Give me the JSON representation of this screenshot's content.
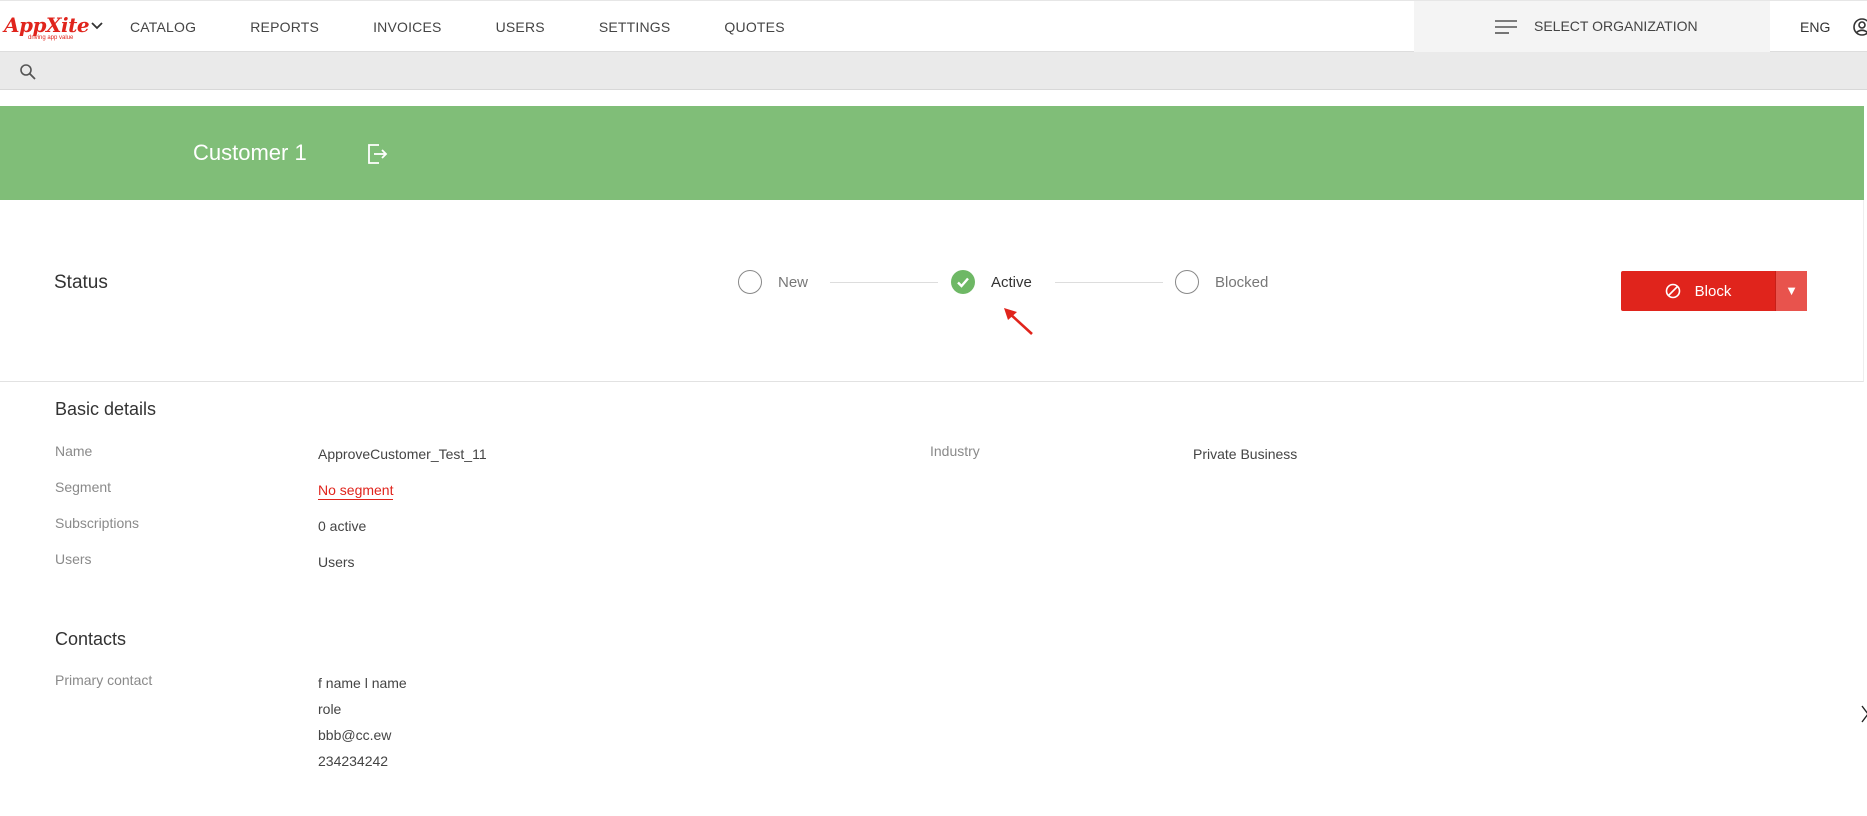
{
  "header": {
    "logo_text": "AppXite",
    "logo_tagline": "driving app value",
    "nav": [
      "CATALOG",
      "REPORTS",
      "INVOICES",
      "USERS",
      "SETTINGS",
      "QUOTES"
    ],
    "org_label": "SELECT ORGANIZATION",
    "language": "ENG"
  },
  "banner": {
    "title": "Customer 1"
  },
  "status": {
    "title": "Status",
    "steps": [
      {
        "label": "New",
        "state": "inactive"
      },
      {
        "label": "Active",
        "state": "current"
      },
      {
        "label": "Blocked",
        "state": "inactive"
      }
    ],
    "block_button": "Block",
    "block_caret": "▼"
  },
  "basic_details": {
    "title": "Basic details",
    "fields": [
      {
        "label": "Name",
        "value": "ApproveCustomer_Test_11"
      },
      {
        "label": "Segment",
        "value": "No segment"
      },
      {
        "label": "Subscriptions",
        "value": "0 active"
      },
      {
        "label": "Users",
        "value": "Users"
      }
    ],
    "industry_label": "Industry",
    "industry_value": "Private Business"
  },
  "contacts": {
    "title": "Contacts",
    "primary_label": "Primary contact",
    "primary_lines": [
      "f name l name",
      "role",
      "bbb@cc.ew",
      "234234242"
    ]
  },
  "colors": {
    "brand_red": "#e0241c",
    "banner_green": "#80be78",
    "status_green": "#6eb865"
  }
}
